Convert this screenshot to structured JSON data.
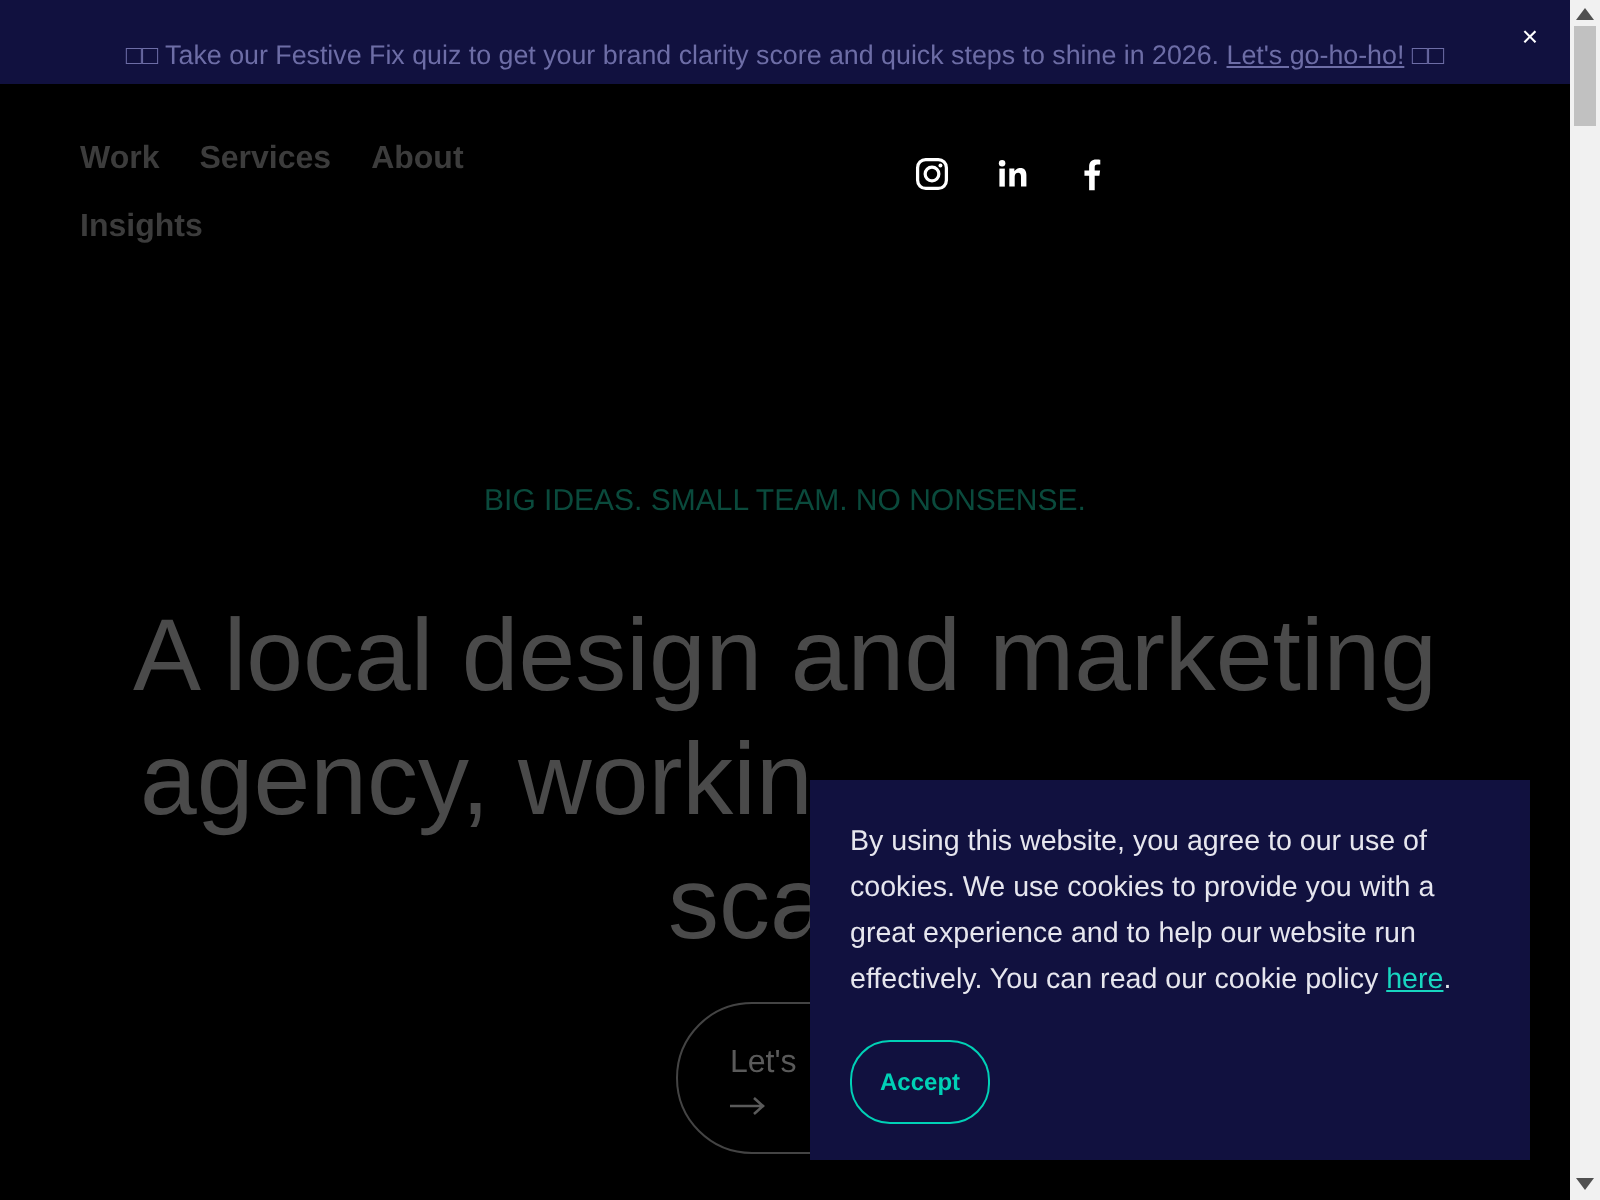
{
  "banner": {
    "text": "□□ Take our Festive Fix quiz to get your brand clarity score and quick steps to shine in 2026. ",
    "link": "Let's go-ho-ho!",
    "suffix": " □□",
    "close": "×"
  },
  "nav": {
    "links": [
      {
        "label": "Work"
      },
      {
        "label": "Services"
      },
      {
        "label": "About"
      },
      {
        "label": "Insights"
      }
    ],
    "social": [
      {
        "kind": "instagram"
      },
      {
        "kind": "linkedin"
      },
      {
        "kind": "facebook"
      }
    ]
  },
  "hero": {
    "tagline": "BIG IDEAS. SMALL TEAM. NO NONSENSE.",
    "headline_lines": [
      "A local design and marketing",
      "agency, workin",
      "sca"
    ],
    "button": "Let's"
  },
  "cookie": {
    "text": "By using this website, you agree to our use of cookies. We use cookies to provide you with a great experience and to help our website run effectively. You can read our cookie policy ",
    "link": "here",
    "end": ".",
    "accept": "Accept"
  }
}
